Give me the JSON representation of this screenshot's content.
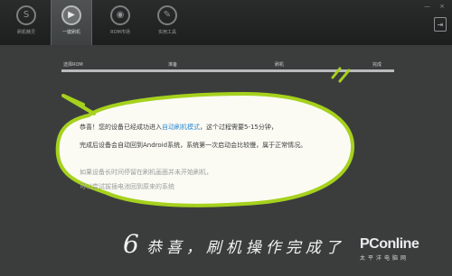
{
  "nav": {
    "items": [
      {
        "label": "刷机精灵",
        "icon": "S-logo-icon"
      },
      {
        "label": "一键刷机",
        "icon": "play-icon"
      },
      {
        "label": "ROM市场",
        "icon": "rom-icon"
      },
      {
        "label": "实用工具",
        "icon": "tools-icon"
      }
    ],
    "active_index": 1
  },
  "window": {
    "minimize": "—",
    "close": "×",
    "exit": "⇥"
  },
  "steps": {
    "labels": [
      "选择ROM",
      "准备",
      "刷机",
      "完成"
    ],
    "progress": 1.0
  },
  "message": {
    "line1_prefix": "恭喜！您的设备已经成功进入",
    "line1_highlight": "自动刷机模式",
    "line1_suffix": "，这个过程需要5-15分钟，",
    "line2": "完成后设备会自动回到Android系统，系统第一次启动会比较慢，属于正常情况。",
    "line3": "如果设备长时间停留在刷机画面并未开始刷机，",
    "line4": "可以尝试拔插电池回到原来的系统"
  },
  "caption": {
    "number": "6",
    "text": "恭喜，刷机操作完成了"
  },
  "watermark": {
    "brand": "PConline",
    "sub": "太平洋电脑网"
  },
  "colors": {
    "highlight": "#2e8bd0",
    "bubble_outline": "#a6d11d",
    "background": "#3b3d3d"
  }
}
